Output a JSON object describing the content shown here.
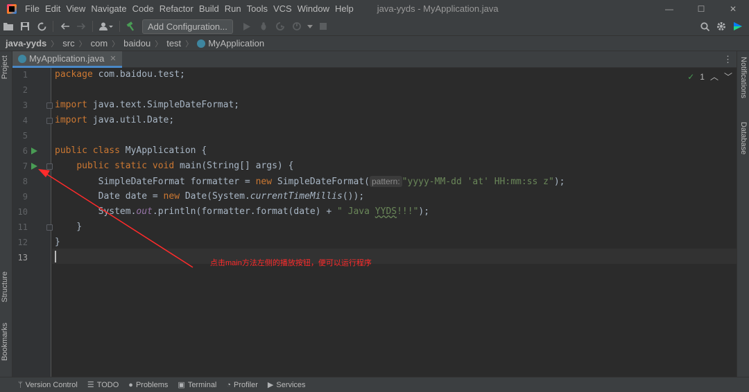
{
  "menubar": {
    "items": [
      "File",
      "Edit",
      "View",
      "Navigate",
      "Code",
      "Refactor",
      "Build",
      "Run",
      "Tools",
      "VCS",
      "Window",
      "Help"
    ],
    "window_title": "java-yyds - MyApplication.java",
    "controls": {
      "minimize": "—",
      "maximize": "☐",
      "close": "✕"
    }
  },
  "toolbar": {
    "add_configuration": "Add Configuration..."
  },
  "breadcrumb": {
    "items": [
      "java-yyds",
      "src",
      "com",
      "baidou",
      "test",
      "MyApplication"
    ]
  },
  "left_stripe": {
    "project": "Project",
    "structure": "Structure",
    "bookmarks": "Bookmarks"
  },
  "right_stripe": {
    "notifications": "Notifications",
    "database": "Database"
  },
  "editor": {
    "tab_label": "MyApplication.java",
    "inspection_count": "1",
    "line_numbers": [
      "1",
      "2",
      "3",
      "4",
      "5",
      "6",
      "7",
      "8",
      "9",
      "10",
      "11",
      "12",
      "13"
    ],
    "code": {
      "l1_kw": "package",
      "l1_rest": " com.baidou.test;",
      "l3_kw": "import",
      "l3_rest": " java.text.SimpleDateFormat;",
      "l4_kw": "import",
      "l4_rest": " java.util.Date;",
      "l6_kw": "public class",
      "l6_rest": " MyApplication {",
      "l7_indent": "    ",
      "l7_kw": "public static void",
      "l7_rest": " main(String[] args) {",
      "l8_a": "        SimpleDateFormat formatter = ",
      "l8_kw": "new",
      "l8_b": " SimpleDateFormat(",
      "l8_hint": "pattern:",
      "l8_str": "\"yyyy-MM-dd 'at' HH:mm:ss z\"",
      "l8_end": ");",
      "l9_a": "        Date date = ",
      "l9_kw": "new",
      "l9_b": " Date(System.",
      "l9_method": "currentTimeMillis",
      "l9_end": "());",
      "l10_a": "        System.",
      "l10_field": "out",
      "l10_b": ".println(formatter.format(date) + ",
      "l10_str1": "\" Java ",
      "l10_typo": "YYDS",
      "l10_str2": "!!!\"",
      "l10_end": ");",
      "l11": "    }",
      "l12": "}"
    }
  },
  "annotation": {
    "text": "点击main方法左侧的播放按钮，便可以运行程序",
    "color": "#ff2b2b"
  },
  "bottom_bar": {
    "items": [
      {
        "icon": "version-control-icon",
        "glyph": "ᛘ",
        "label": "Version Control"
      },
      {
        "icon": "todo-icon",
        "glyph": "☰",
        "label": "TODO"
      },
      {
        "icon": "problems-icon",
        "glyph": "●",
        "label": "Problems"
      },
      {
        "icon": "terminal-icon",
        "glyph": "▣",
        "label": "Terminal"
      },
      {
        "icon": "profiler-icon",
        "glyph": "◔",
        "label": "Profiler"
      },
      {
        "icon": "services-icon",
        "glyph": "▶",
        "label": "Services"
      }
    ]
  },
  "colors": {
    "keyword": "#cc7832",
    "string": "#6a8759",
    "run_icon": "#499c54"
  }
}
